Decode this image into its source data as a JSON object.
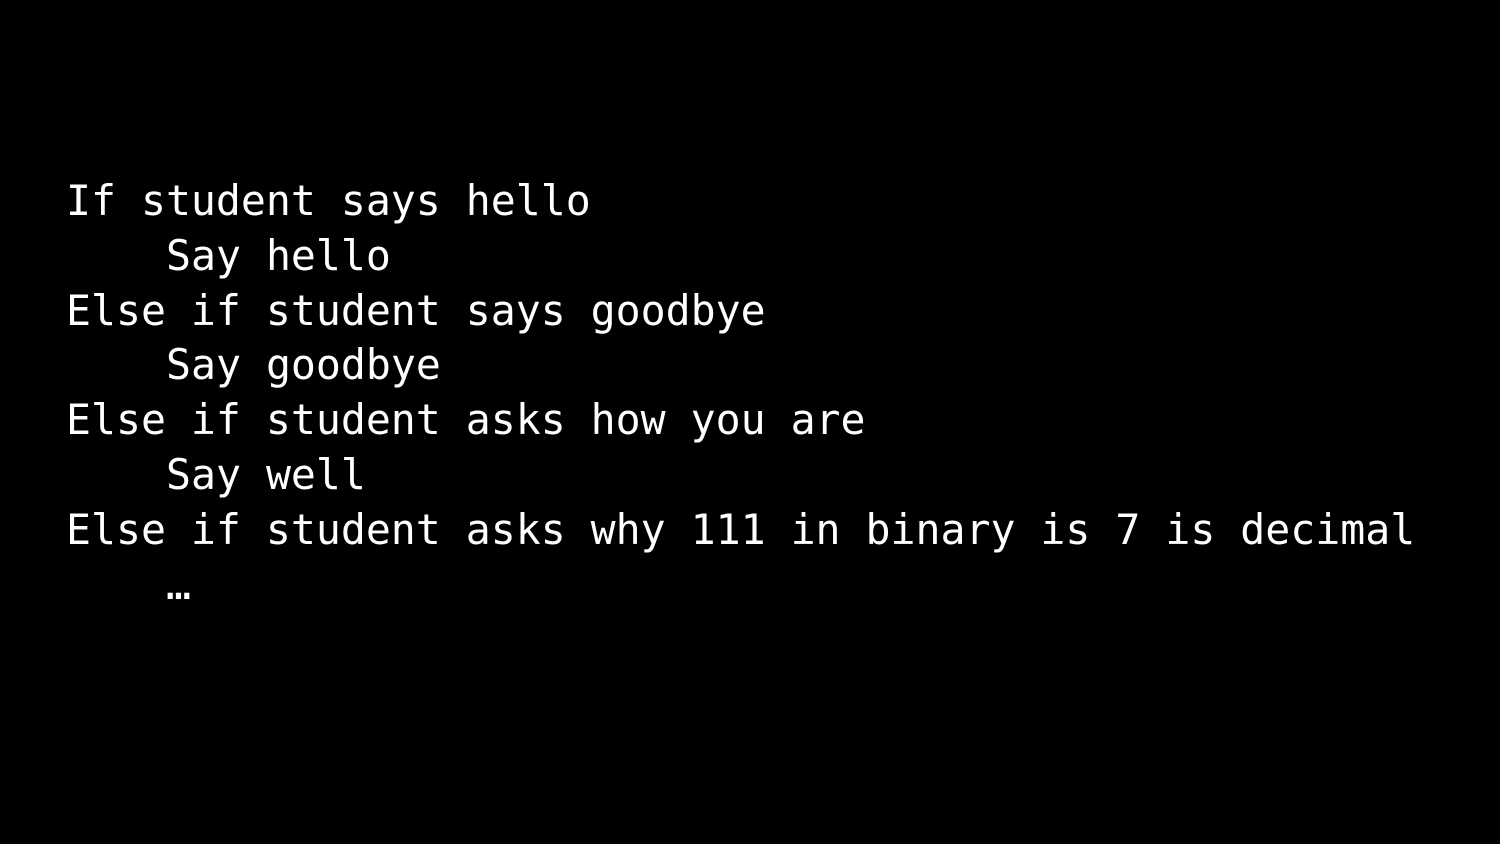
{
  "colors": {
    "background": "#000000",
    "text": "#ffffff"
  },
  "pseudocode": {
    "lines": [
      {
        "text": "If student says hello",
        "indent": false
      },
      {
        "text": "Say hello",
        "indent": true
      },
      {
        "text": "Else if student says goodbye",
        "indent": false
      },
      {
        "text": "Say goodbye",
        "indent": true
      },
      {
        "text": "Else if student asks how you are",
        "indent": false
      },
      {
        "text": "Say well",
        "indent": true
      },
      {
        "text": "Else if student asks why 111 in binary is 7 is decimal",
        "indent": false
      },
      {
        "text": "…",
        "indent": true
      }
    ]
  }
}
